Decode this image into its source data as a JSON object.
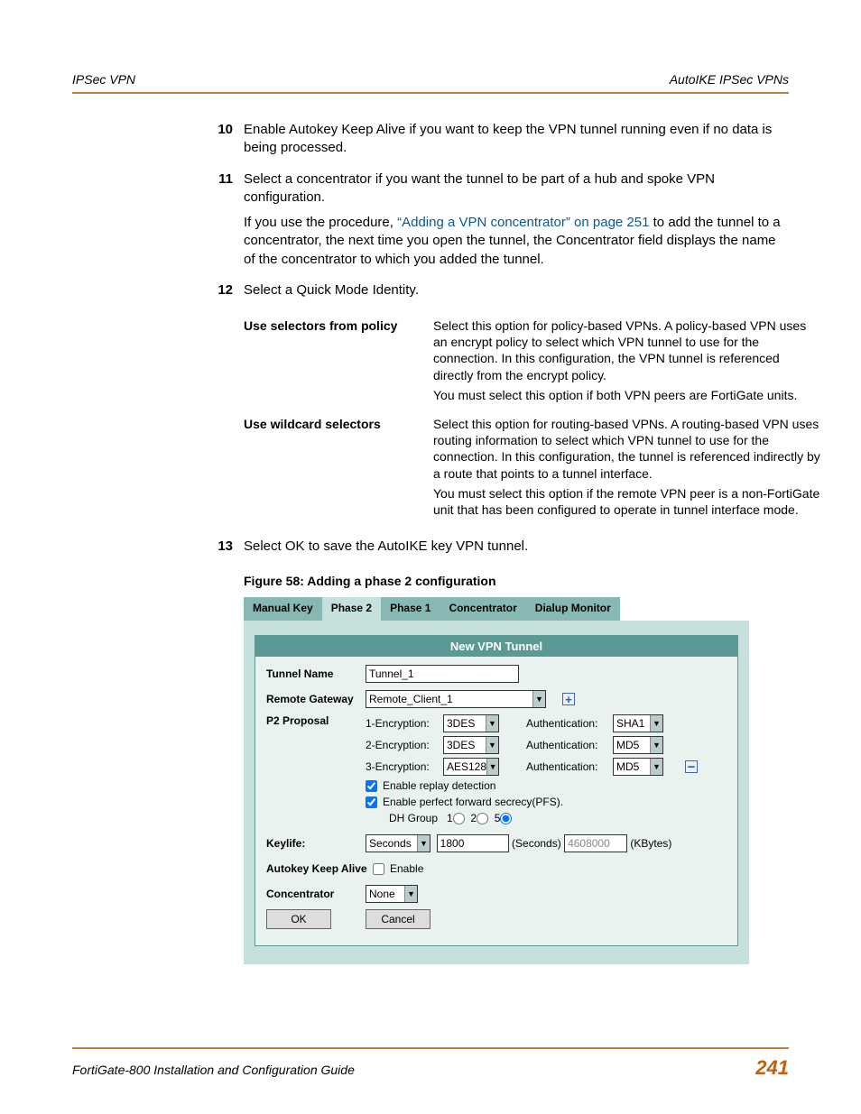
{
  "header": {
    "left": "IPSec VPN",
    "right": "AutoIKE IPSec VPNs"
  },
  "steps": {
    "s10": {
      "num": "10",
      "text": "Enable Autokey Keep Alive if you want to keep the VPN tunnel running even if no data is being processed."
    },
    "s11": {
      "num": "11",
      "p1": "Select a concentrator if you want the tunnel to be part of a hub and spoke VPN configuration.",
      "p2a": "If you use the procedure, ",
      "link": "“Adding a VPN concentrator” on page 251",
      "p2b": " to add the tunnel to a concentrator, the next time you open the tunnel, the Concentrator field displays the name of the concentrator to which you added the tunnel."
    },
    "s12": {
      "num": "12",
      "text": "Select a Quick Mode Identity."
    },
    "s13": {
      "num": "13",
      "text": "Select OK to save the AutoIKE key VPN tunnel."
    }
  },
  "qm": {
    "r1": {
      "label": "Use selectors from policy",
      "d1": "Select this option for policy-based VPNs. A policy-based VPN uses an encrypt policy to select which VPN tunnel to use for the connection. In this configuration, the VPN tunnel is referenced directly from the encrypt policy.",
      "d2": "You must select this option if both VPN peers are FortiGate units."
    },
    "r2": {
      "label": "Use wildcard selectors",
      "d1": "Select this option for routing-based VPNs. A routing-based VPN uses routing information to select which VPN tunnel to use for the connection. In this configuration, the tunnel is referenced indirectly by a route that points to a tunnel interface.",
      "d2": "You must select this option if the remote VPN peer is a non-FortiGate unit that has been configured to operate in tunnel interface mode."
    }
  },
  "figcaption": "Figure 58: Adding a phase 2 configuration",
  "ui": {
    "tabs": {
      "manual": "Manual Key",
      "p2": "Phase 2",
      "p1": "Phase 1",
      "conc": "Concentrator",
      "dial": "Dialup Monitor"
    },
    "panelTitle": "New VPN Tunnel",
    "labels": {
      "tunnel": "Tunnel Name",
      "gateway": "Remote Gateway",
      "p2prop": "P2 Proposal",
      "keylife": "Keylife:",
      "autokey": "Autokey Keep Alive",
      "conc": "Concentrator",
      "enc1": "1-Encryption:",
      "enc2": "2-Encryption:",
      "enc3": "3-Encryption:",
      "auth": "Authentication:",
      "replay": "Enable replay detection",
      "pfs": "Enable perfect forward secrecy(PFS).",
      "dhgroup": "DH Group",
      "dh1": "1",
      "dh2": "2",
      "dh5": "5",
      "seconds": "(Seconds)",
      "kbytes": "(KBytes)",
      "enable": "Enable"
    },
    "values": {
      "tunnel": "Tunnel_1",
      "gateway": "Remote_Client_1",
      "enc1": "3DES",
      "enc2": "3DES",
      "enc3": "AES128",
      "auth1": "SHA1",
      "auth2": "MD5",
      "auth3": "MD5",
      "keylife_unit": "Seconds",
      "keylife_sec": "1800",
      "keylife_kb": "4608000",
      "conc": "None"
    },
    "buttons": {
      "ok": "OK",
      "cancel": "Cancel"
    }
  },
  "footer": {
    "title": "FortiGate-800 Installation and Configuration Guide",
    "page": "241"
  }
}
